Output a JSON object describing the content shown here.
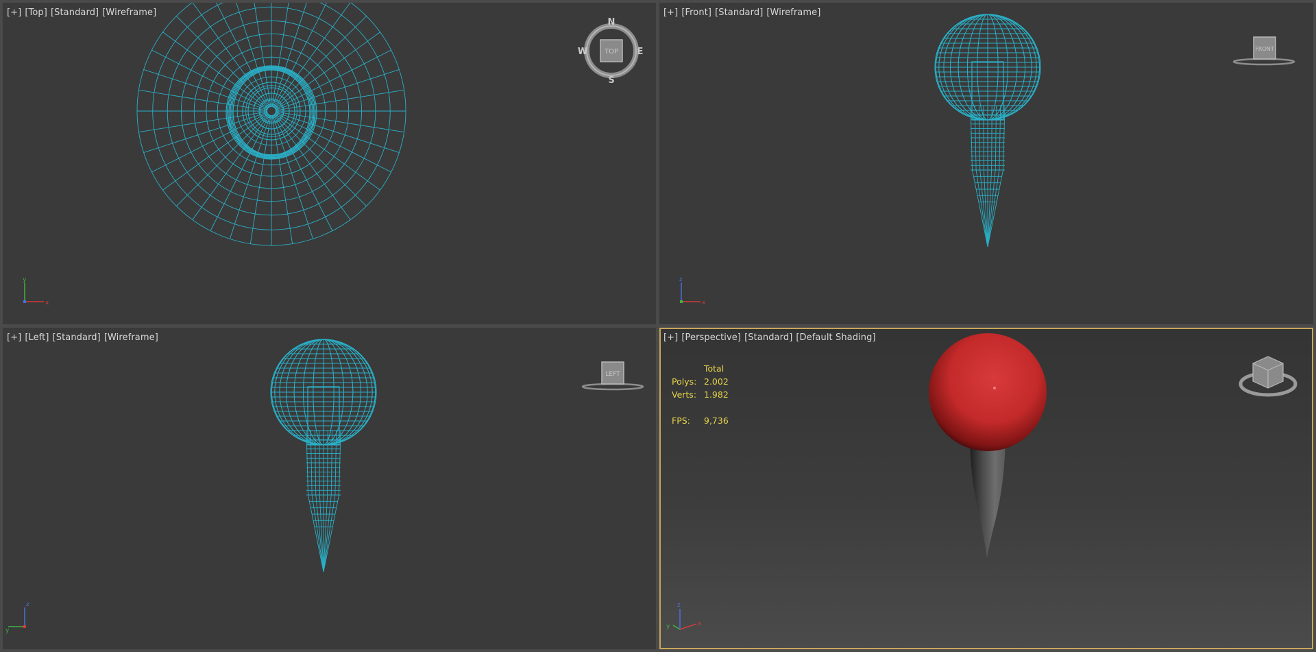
{
  "viewports": {
    "top": {
      "labels": [
        "[+]",
        "[Top]",
        "[Standard]",
        "[Wireframe]"
      ],
      "viewcube": {
        "face": "TOP",
        "compass": {
          "n": "N",
          "s": "S",
          "e": "E",
          "w": "W"
        }
      },
      "axes": {
        "v": "y",
        "h": "x"
      }
    },
    "front": {
      "labels": [
        "[+]",
        "[Front]",
        "[Standard]",
        "[Wireframe]"
      ],
      "viewcube": {
        "face": "FRONT"
      },
      "axes": {
        "v": "z",
        "h": "x"
      }
    },
    "left": {
      "labels": [
        "[+]",
        "[Left]",
        "[Standard]",
        "[Wireframe]"
      ],
      "viewcube": {
        "face": "LEFT"
      },
      "axes": {
        "v": "z",
        "h": "y"
      }
    },
    "perspective": {
      "labels": [
        "[+]",
        "[Perspective]",
        "[Standard]",
        "[Default Shading]"
      ],
      "stats": {
        "header": "Total",
        "polys_label": "Polys:",
        "polys": "2.002",
        "verts_label": "Verts:",
        "verts": "1.982",
        "fps_label": "FPS:",
        "fps": "9,736"
      },
      "axes": {
        "v": "z",
        "h": "x",
        "d": "y"
      }
    }
  },
  "colors": {
    "wire": "#2ab0c8",
    "active_border": "#c8a65a",
    "sphere": "#c42a2a",
    "stats_text": "#e6d34a",
    "axis_x": "#d23b3b",
    "axis_y": "#3fb33f",
    "axis_z": "#4a6fdc"
  }
}
